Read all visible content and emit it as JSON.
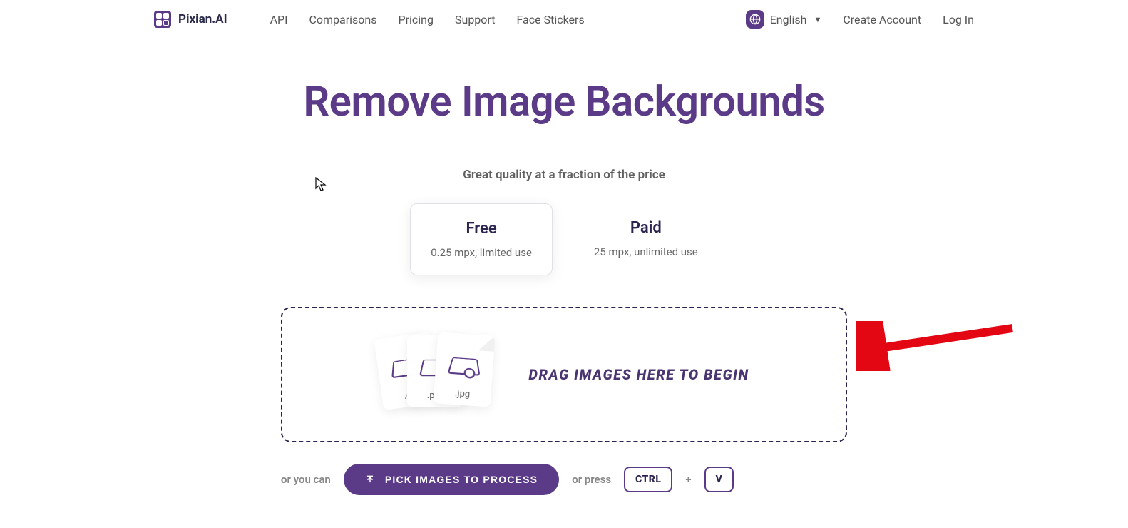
{
  "brand": "Pixian.AI",
  "nav": {
    "items": [
      "API",
      "Comparisons",
      "Pricing",
      "Support",
      "Face Stickers"
    ]
  },
  "header_right": {
    "language": "English",
    "create_account": "Create Account",
    "log_in": "Log In"
  },
  "hero": {
    "title": "Remove Image Backgrounds",
    "tagline": "Great quality at a fraction of the price"
  },
  "plans": [
    {
      "title": "Free",
      "sub": "0.25 mpx, limited use",
      "active": true
    },
    {
      "title": "Paid",
      "sub": "25 mpx, unlimited use",
      "active": false
    }
  ],
  "dropzone": {
    "text": "DRAG IMAGES HERE TO BEGIN",
    "exts": [
      ".gif",
      ".png",
      ".jpg"
    ]
  },
  "actions": {
    "or_you_can": "or you can",
    "pick_button": "PICK IMAGES TO PROCESS",
    "or_press": "or press",
    "key1": "CTRL",
    "plus": "+",
    "key2": "V"
  }
}
